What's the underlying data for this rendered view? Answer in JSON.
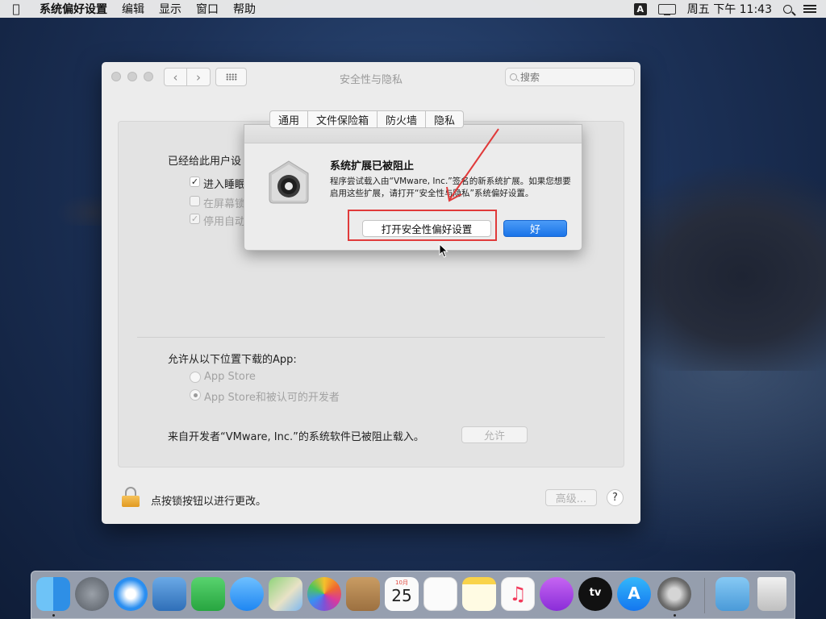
{
  "menubar": {
    "app_name": "系统偏好设置",
    "menus": [
      "编辑",
      "显示",
      "窗口",
      "帮助"
    ],
    "ime": "A",
    "clock": "周五 下午 11:43"
  },
  "window": {
    "title": "安全性与隐私",
    "search_placeholder": "搜索",
    "tabs": [
      "通用",
      "文件保险箱",
      "防火墙",
      "隐私"
    ],
    "general": {
      "password_heading": "已经给此用户设",
      "checkboxes": [
        {
          "label": "进入睡眠",
          "checked": true
        },
        {
          "label": "在屏幕锁",
          "checked": false
        },
        {
          "label": "停用自动",
          "checked": true
        }
      ],
      "download_heading": "允许从以下位置下载的App:",
      "radio_options": [
        {
          "label": "App Store",
          "selected": false
        },
        {
          "label": "App Store和被认可的开发者",
          "selected": true
        }
      ],
      "blocked_text": "来自开发者“VMware, Inc.”的系统软件已被阻止载入。",
      "allow_button": "允许"
    },
    "footer": {
      "lock_text": "点按锁按钮以进行更改。",
      "advanced_button": "高级...",
      "help_button": "?"
    }
  },
  "dialog": {
    "title": "系统扩展已被阻止",
    "message": "程序尝试载入由“VMware, Inc.”签名的新系统扩展。如果您想要启用这些扩展，请打开“安全性与隐私”系统偏好设置。",
    "open_button": "打开安全性偏好设置",
    "ok_button": "好"
  },
  "dock": {
    "apps": [
      "finder",
      "launchpad",
      "safari",
      "mail",
      "facetime",
      "messages",
      "maps",
      "photos",
      "contacts",
      "calendar",
      "reminders",
      "notes",
      "music",
      "podcasts",
      "tv",
      "app-store",
      "system-preferences"
    ],
    "calendar_month": "10月",
    "calendar_day": "25",
    "tv_label": "tv",
    "extras": [
      "downloads",
      "trash"
    ]
  }
}
